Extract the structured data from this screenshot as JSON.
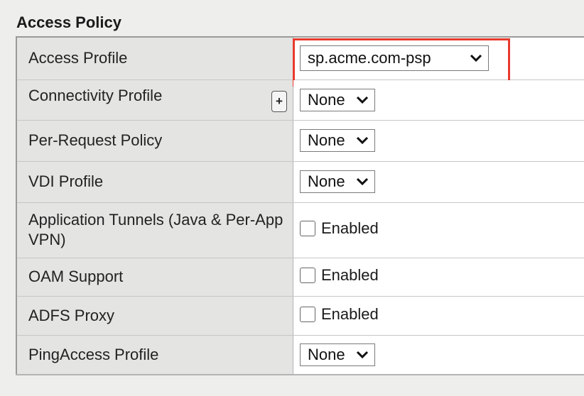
{
  "section": {
    "title": "Access Policy"
  },
  "rows": [
    {
      "label": "Access Profile",
      "control": "select",
      "value": "sp.acme.com-psp",
      "highlighted": true
    },
    {
      "label": "Connectivity Profile",
      "control": "select",
      "value": "None",
      "has_plus_button": true,
      "plus_label": "+"
    },
    {
      "label": "Per-Request Policy",
      "control": "select",
      "value": "None"
    },
    {
      "label": "VDI Profile",
      "control": "select",
      "value": "None"
    },
    {
      "label": "Application Tunnels (Java & Per-App VPN)",
      "control": "checkbox",
      "value": "Enabled",
      "checked": false
    },
    {
      "label": "OAM Support",
      "control": "checkbox",
      "value": "Enabled",
      "checked": false
    },
    {
      "label": "ADFS Proxy",
      "control": "checkbox",
      "value": "Enabled",
      "checked": false
    },
    {
      "label": "PingAccess Profile",
      "control": "select",
      "value": "None"
    }
  ],
  "colors": {
    "highlight": "#e83a2e",
    "label_bg": "#e4e4e2",
    "value_bg": "#ffffff"
  },
  "icons": {
    "dropdown": "chevron-down-icon",
    "add": "plus-icon"
  }
}
